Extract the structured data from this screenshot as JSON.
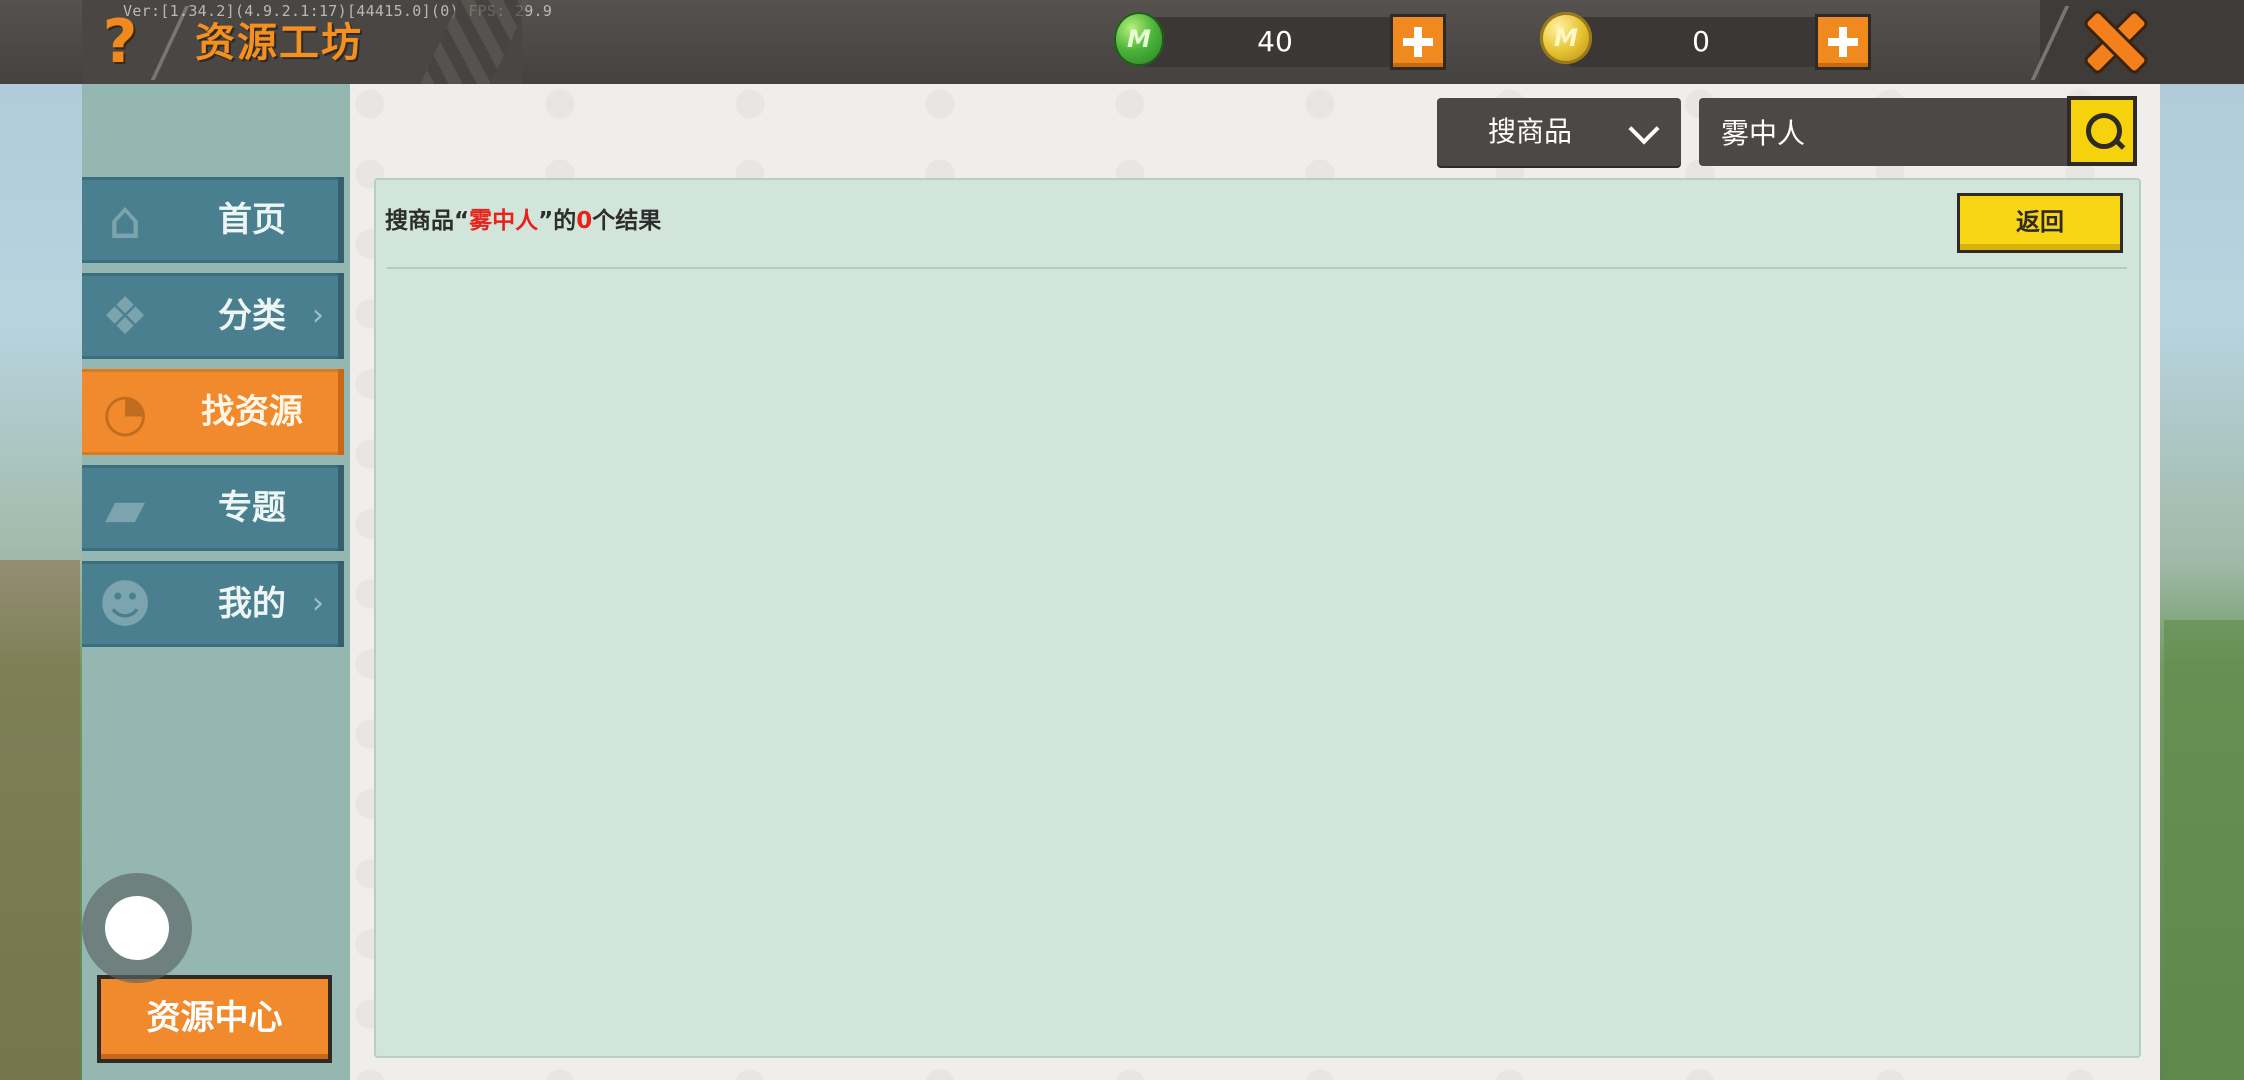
{
  "header": {
    "version_text": "Ver:[1.34.2](4.9.2.1:17)[44415.0](0) FPS: 29.9",
    "title": "资源工坊",
    "help_icon": "?",
    "gems": {
      "icon": "gem-icon",
      "icon_letter": "M",
      "value": "40",
      "color": "#4bb43a"
    },
    "coins": {
      "icon": "coin-icon",
      "icon_letter": "M",
      "value": "0",
      "color": "#e6c22f"
    }
  },
  "sidebar": {
    "items": [
      {
        "label": "首页",
        "icon": "home-icon",
        "glyph": "⌂",
        "has_chevron": false,
        "active": false
      },
      {
        "label": "分类",
        "icon": "category-icon",
        "glyph": "❖",
        "has_chevron": true,
        "chevron": "›",
        "active": false
      },
      {
        "label": "找资源",
        "icon": "search-resource-icon",
        "glyph": "◔",
        "has_chevron": false,
        "active": true
      },
      {
        "label": "专题",
        "icon": "topic-icon",
        "glyph": "▰",
        "has_chevron": false,
        "active": false
      },
      {
        "label": "我的",
        "icon": "profile-icon",
        "glyph": "☻",
        "has_chevron": true,
        "chevron": "›",
        "active": false
      }
    ],
    "resource_center_label": "资源中心"
  },
  "search": {
    "filter_label": "搜商品",
    "query": "雾中人"
  },
  "results": {
    "prefix": "搜商品“",
    "query": "雾中人",
    "middle": "”的",
    "count": "0",
    "suffix": "个结果",
    "back_label": "返回"
  },
  "colors": {
    "accent_orange": "#f08a2c",
    "accent_yellow": "#f8d615",
    "nav_blue": "#4a7f90",
    "results_bg": "#d2e5db",
    "highlight_red": "#e8221b"
  }
}
